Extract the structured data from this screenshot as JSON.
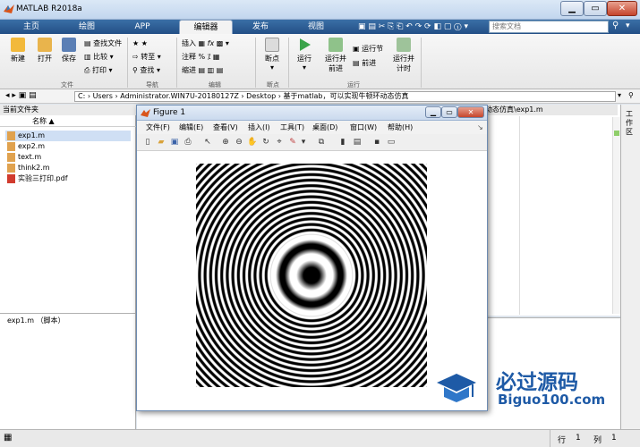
{
  "window": {
    "title": "MATLAB R2018a",
    "minimize": "▁",
    "maximize": "▭",
    "close": "✕"
  },
  "tabs": [
    "主页",
    "绘图",
    "APP",
    "编辑器",
    "发布",
    "视图"
  ],
  "search": {
    "placeholder": "搜索文档"
  },
  "ribbon": {
    "file": {
      "new": "新建",
      "open": "打开",
      "save": "保存",
      "find_files": "查找文件",
      "compare": "比较",
      "print": "打印",
      "group": "文件"
    },
    "navigate": {
      "goto": "转至",
      "find": "查找",
      "group": "导航"
    },
    "edit": {
      "insert": "插入",
      "comment": "注释",
      "indent": "缩进",
      "group": "编辑"
    },
    "breakpoints": {
      "label": "断点",
      "group": "断点"
    },
    "run": {
      "run": "运行",
      "run_advance": "运行并\n前进",
      "run_section": "运行节",
      "advance": "前进",
      "run_time": "运行并\n计时",
      "group": "运行"
    }
  },
  "address": {
    "path": "C: › Users › Administrator.WIN7U-20180127Z › Desktop › 基于matlab，可以实现牛顿环动态仿真"
  },
  "filepanel": {
    "title": "当前文件夹",
    "column": "名称 ▲",
    "files": [
      "exp1.m",
      "exp2.m",
      "text.m",
      "think2.m",
      "实验三打印.pdf"
    ],
    "detail": "exp1.m （脚本）"
  },
  "editor": {
    "tab": "动态仿真\\exp1.m",
    "right_label": "工作区"
  },
  "figure": {
    "title": "Figure 1",
    "menus": [
      "文件(F)",
      "编辑(E)",
      "查看(V)",
      "插入(I)",
      "工具(T)",
      "桌面(D)",
      "窗口(W)",
      "帮助(H)"
    ]
  },
  "statusbar": {
    "row_label": "行",
    "row_value": "1",
    "col_label": "列",
    "col_value": "1"
  },
  "watermark": {
    "brand": "必过源码",
    "url": "Biguo100.com"
  }
}
